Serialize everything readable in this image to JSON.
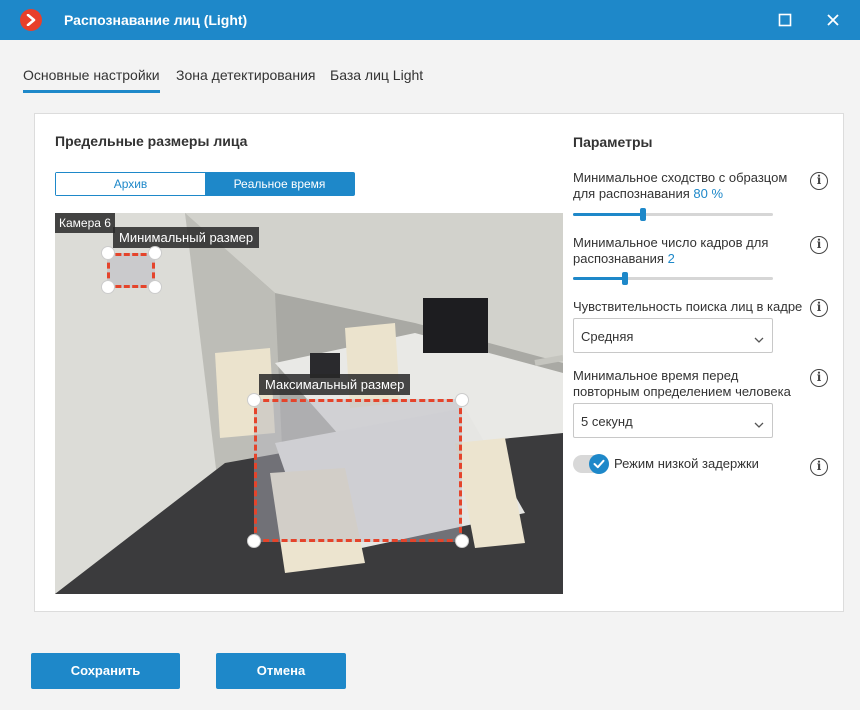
{
  "window": {
    "title": "Распознавание лиц (Light)"
  },
  "tabs": [
    {
      "label": "Основные настройки",
      "active": true
    },
    {
      "label": "Зона детектирования",
      "active": false
    },
    {
      "label": "База лиц Light",
      "active": false
    }
  ],
  "left": {
    "title": "Предельные размеры лица",
    "mode_options": [
      "Архив",
      "Реальное время"
    ],
    "mode_selected": "Реальное время",
    "camera_label": "Камера 6",
    "min_size_label": "Минимальный размер",
    "max_size_label": "Максимальный размер"
  },
  "params": {
    "title": "Параметры",
    "similarity": {
      "label": "Минимальное сходство с образцом для распознавания",
      "value": "80",
      "unit": "%",
      "fraction": 0.35
    },
    "frames": {
      "label": "Минимальное число кадров для распознавания",
      "value": "2",
      "fraction": 0.26
    },
    "sensitivity": {
      "label": "Чувствительность поиска лиц в кадре",
      "value": "Средняя"
    },
    "repeat_time": {
      "label": "Минимальное время перед повторным определением человека",
      "value": "5 секунд"
    },
    "low_latency": {
      "label": "Режим низкой задержки",
      "enabled": true
    }
  },
  "buttons": {
    "save": "Сохранить",
    "cancel": "Отмена"
  },
  "colors": {
    "accent": "#1e88c9",
    "logo": "#e8402b",
    "zone_border": "#e5442b"
  },
  "icons": [
    "app-logo-icon",
    "maximize-icon",
    "close-icon",
    "info-icon",
    "chevron-down-icon"
  ]
}
